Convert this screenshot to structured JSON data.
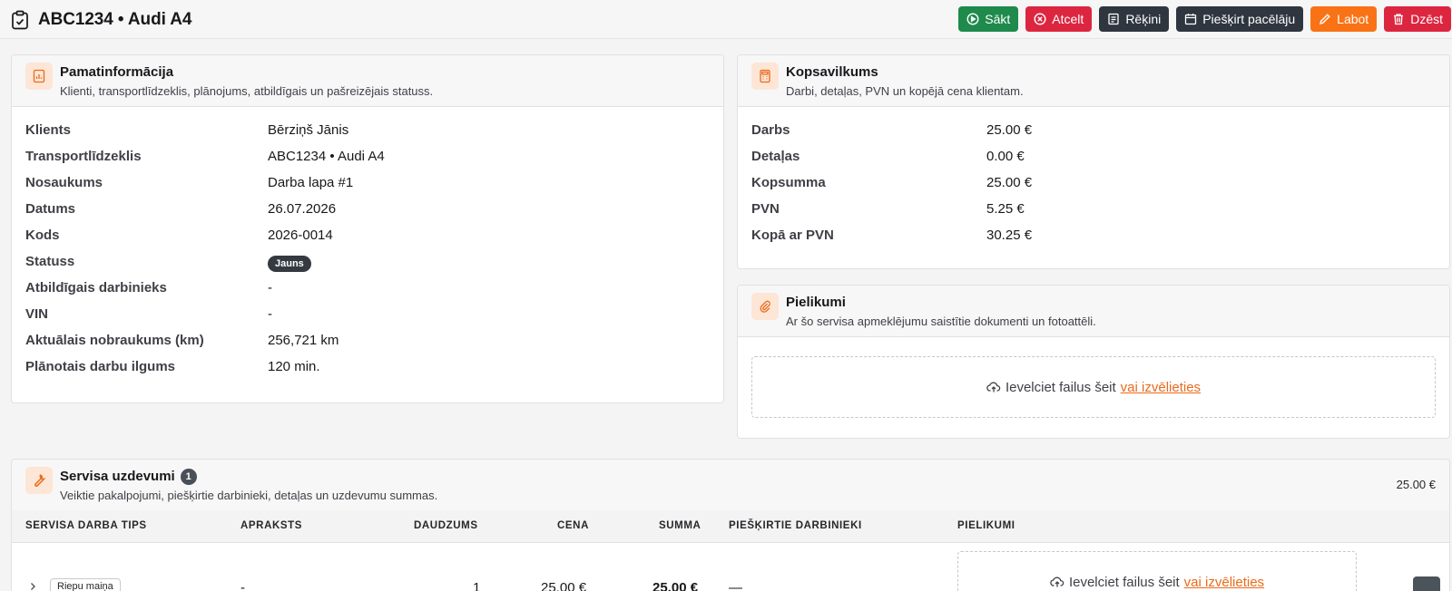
{
  "header": {
    "title": "ABC1234 • Audi A4",
    "actions": {
      "start": "Sākt",
      "cancel": "Atcelt",
      "invoices": "Rēķini",
      "assign_lift": "Piešķirt pacēlāju",
      "edit": "Labot",
      "delete": "Dzēst"
    }
  },
  "basic_info": {
    "title": "Pamatinformācija",
    "subtitle": "Klienti, transportlīdzeklis, plānojums, atbildīgais un pašreizējais statuss.",
    "fields": [
      {
        "label": "Klients",
        "value": "Bērziņš Jānis"
      },
      {
        "label": "Transportlīdzeklis",
        "value": "ABC1234 • Audi A4"
      },
      {
        "label": "Nosaukums",
        "value": "Darba lapa #1"
      },
      {
        "label": "Datums",
        "value": "26.07.2026"
      },
      {
        "label": "Kods",
        "value": "2026-0014"
      },
      {
        "label": "Statuss",
        "value": "Jauns"
      },
      {
        "label": "Atbildīgais darbinieks",
        "value": "-"
      },
      {
        "label": "VIN",
        "value": "-"
      },
      {
        "label": "Aktuālais nobraukums (km)",
        "value": "256,721 km"
      },
      {
        "label": "Plānotais darbu ilgums",
        "value": "120 min."
      }
    ]
  },
  "summary": {
    "title": "Kopsavilkums",
    "subtitle": "Darbi, detaļas, PVN un kopējā cena klientam.",
    "fields": [
      {
        "label": "Darbs",
        "value": "25.00 €"
      },
      {
        "label": "Detaļas",
        "value": "0.00 €"
      },
      {
        "label": "Kopsumma",
        "value": "25.00 €"
      },
      {
        "label": "PVN",
        "value": "5.25 €"
      },
      {
        "label": "Kopā ar PVN",
        "value": "30.25 €"
      }
    ]
  },
  "attachments": {
    "title": "Pielikumi",
    "subtitle": "Ar šo servisa apmeklējumu saistītie dokumenti un fotoattēli.",
    "drop_text": "Ievelciet failus šeit",
    "drop_link": "vai izvēlieties"
  },
  "tasks": {
    "title": "Servisa uzdevumi",
    "count": "1",
    "subtitle": "Veiktie pakalpojumi, piešķirtie darbinieki, detaļas un uzdevumu summas.",
    "total": "25.00 €",
    "columns": [
      "SERVISA DARBA TIPS",
      "APRAKSTS",
      "DAUDZUMS",
      "CENA",
      "SUMMA",
      "PIEŠĶIRTIE DARBINIEKI",
      "PIELIKUMI"
    ],
    "rows": [
      {
        "type": "Riepu maiņa",
        "description": "-",
        "quantity": "1",
        "price": "25.00 €",
        "sum": "25.00 €",
        "workers": "—",
        "drop_text": "Ievelciet failus šeit",
        "drop_link": "vai izvēlieties"
      }
    ]
  },
  "colors": {
    "accent": "#ea6a1b",
    "green": "#1e8a4c",
    "red": "#dc2640",
    "dark": "#2f3640",
    "orange": "#f97316"
  }
}
